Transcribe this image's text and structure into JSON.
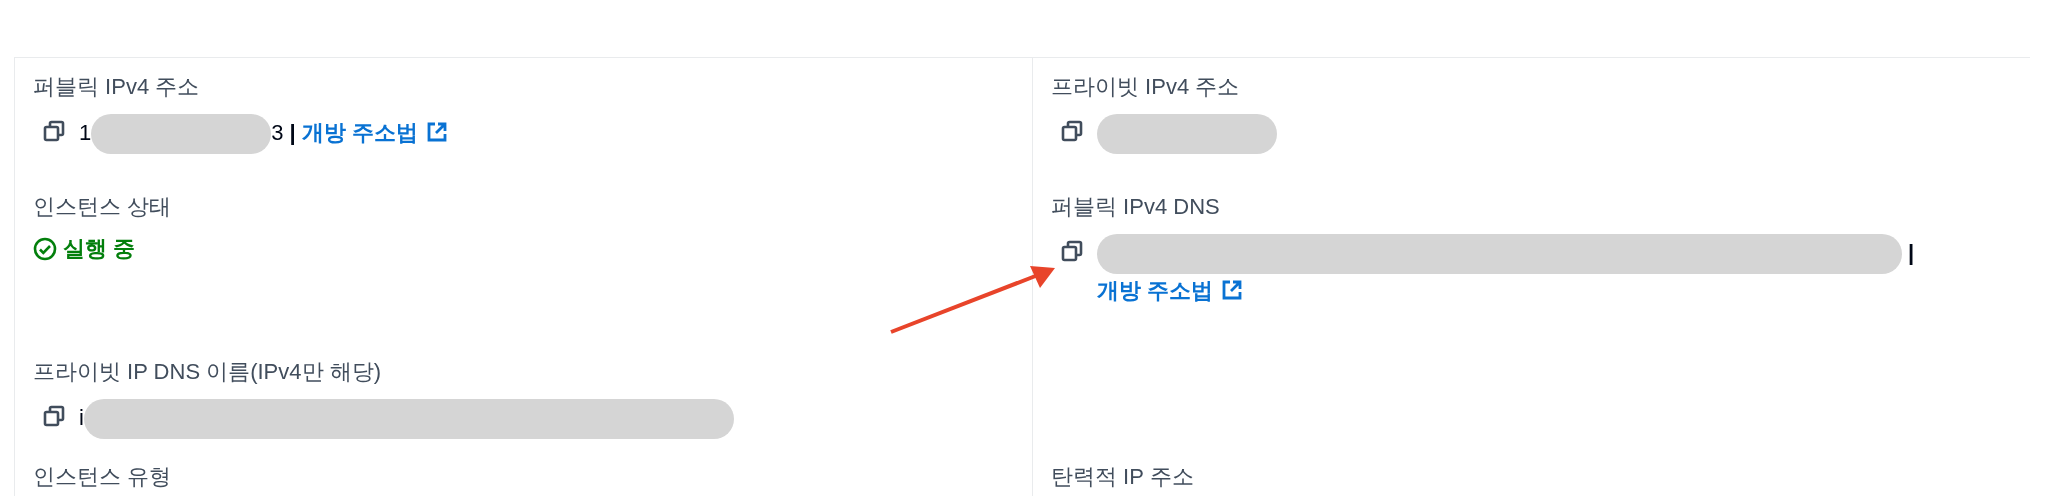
{
  "rows": [
    {
      "left": {
        "label": "퍼블릭 IPv4 주소",
        "value": {
          "prefix": "1",
          "redacted": true,
          "suffix": "3",
          "separator": "|",
          "link": "개방 주소법"
        },
        "copy": true
      },
      "right": {
        "label": "프라이빗 IPv4 주소",
        "value": {
          "redacted": true
        },
        "copy": true
      }
    },
    {
      "left": {
        "label": "인스턴스 상태",
        "status": {
          "text": "실행 중",
          "kind": "running"
        }
      },
      "right": {
        "label": "퍼블릭 IPv4 DNS",
        "value": {
          "redacted": true,
          "wide": true,
          "separator": "|",
          "link": "개방 주소법"
        },
        "copy": true
      }
    },
    {
      "left": {
        "label": "프라이빗 IP DNS 이름(IPv4만 해당)",
        "value": {
          "prefix": "i",
          "redacted": true,
          "wide": true
        },
        "copy": true
      }
    },
    {
      "left": {
        "label": "인스턴스 유형"
      },
      "right": {
        "label": "탄력적 IP 주소"
      }
    }
  ],
  "annotation": {
    "kind": "arrow"
  }
}
